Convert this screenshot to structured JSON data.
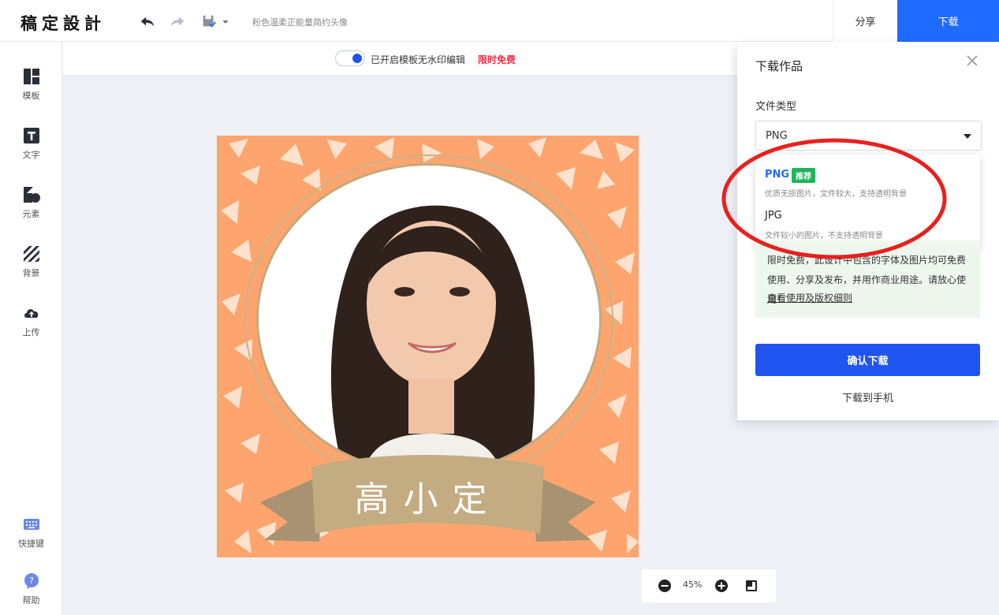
{
  "header": {
    "logo": "稿定設計",
    "doc_title": "粉色温柔正能量简约头像",
    "share_label": "分享",
    "download_label": "下载"
  },
  "sidebar": {
    "items": [
      {
        "label": "模板",
        "icon": "template-icon"
      },
      {
        "label": "文字",
        "icon": "text-icon"
      },
      {
        "label": "元素",
        "icon": "element-icon"
      },
      {
        "label": "背景",
        "icon": "background-icon"
      },
      {
        "label": "上传",
        "icon": "upload-icon"
      }
    ],
    "bottom": [
      {
        "label": "快捷键",
        "icon": "keyboard-icon"
      },
      {
        "label": "帮助",
        "icon": "help-icon"
      }
    ]
  },
  "watermark": {
    "text": "已开启模板无水印编辑",
    "free_label": "限时免费",
    "enabled": true
  },
  "canvas": {
    "name_text": "高小定",
    "background_color": "#fea46e"
  },
  "zoom": {
    "level": "45%"
  },
  "download_panel": {
    "title": "下载作品",
    "file_type_label": "文件类型",
    "selected_type": "PNG",
    "options": [
      {
        "name": "PNG",
        "badge": "推荐",
        "desc": "优质无损图片，文件较大，支持透明背景",
        "selected": true
      },
      {
        "name": "JPG",
        "badge": "",
        "desc": "文件较小的图片，不支持透明背景",
        "selected": false
      }
    ],
    "info_text": "限时免费，此设计中包含的字体及图片均可免费使用、分享及发布，并用作商业用途。请放心使用！",
    "info_link": "查看使用及版权细则",
    "confirm_label": "确认下载",
    "phone_label": "下载到手机"
  },
  "colors": {
    "accent": "#1f6bff",
    "confirm": "#1f54f0",
    "badge_green": "#21b45b",
    "free_red": "#f0304a",
    "annotation_red": "#e8201e"
  }
}
